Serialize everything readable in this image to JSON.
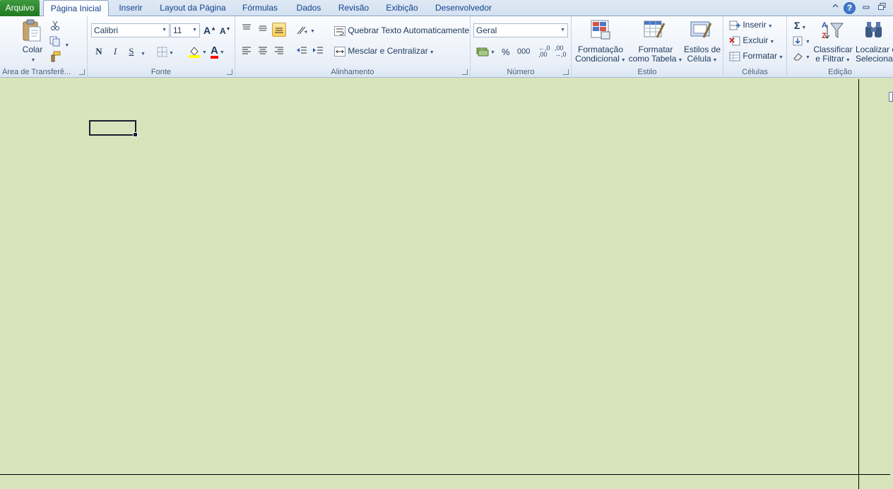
{
  "tabs": {
    "file": "Arquivo",
    "home": "Página Inicial",
    "insert": "Inserir",
    "layout": "Layout da Página",
    "formulas": "Fórmulas",
    "data": "Dados",
    "review": "Revisão",
    "view": "Exibição",
    "developer": "Desenvolvedor"
  },
  "groups": {
    "clipboard": "Área de Transferê...",
    "font": "Fonte",
    "alignment": "Alinhamento",
    "number": "Número",
    "style": "Estilo",
    "cells": "Células",
    "editing": "Edição"
  },
  "clipboard": {
    "paste": "Colar"
  },
  "font": {
    "name": "Calibri",
    "size": "11",
    "bold": "N",
    "italic": "I",
    "underline": "S",
    "grow": "A",
    "shrink": "A",
    "color_letter": "A",
    "fill_color": "#ffff00",
    "font_color": "#ff0000"
  },
  "alignment": {
    "wrap_text": "Quebrar Texto Automaticamente",
    "merge_center": "Mesclar e Centralizar"
  },
  "number": {
    "format": "Geral",
    "percent": "%",
    "thousands": "000",
    "inc_decimal": "←,0 ,00",
    "dec_decimal": ",00 →,0"
  },
  "style": {
    "conditional_line1": "Formatação",
    "conditional_line2": "Condicional",
    "table_line1": "Formatar",
    "table_line2": "como Tabela",
    "cell_line1": "Estilos de",
    "cell_line2": "Célula"
  },
  "cells": {
    "insert": "Inserir",
    "delete": "Excluir",
    "format": "Formatar"
  },
  "editing": {
    "sum": "Σ",
    "sort_line1": "Classificar",
    "sort_line2": "e Filtrar",
    "find_line1": "Localizar e",
    "find_line2": "Selecionar"
  },
  "window": {
    "help": "?"
  },
  "colors": {
    "sheet_bg": "#d8e4bc",
    "file_tab": "#2a8a2a"
  }
}
